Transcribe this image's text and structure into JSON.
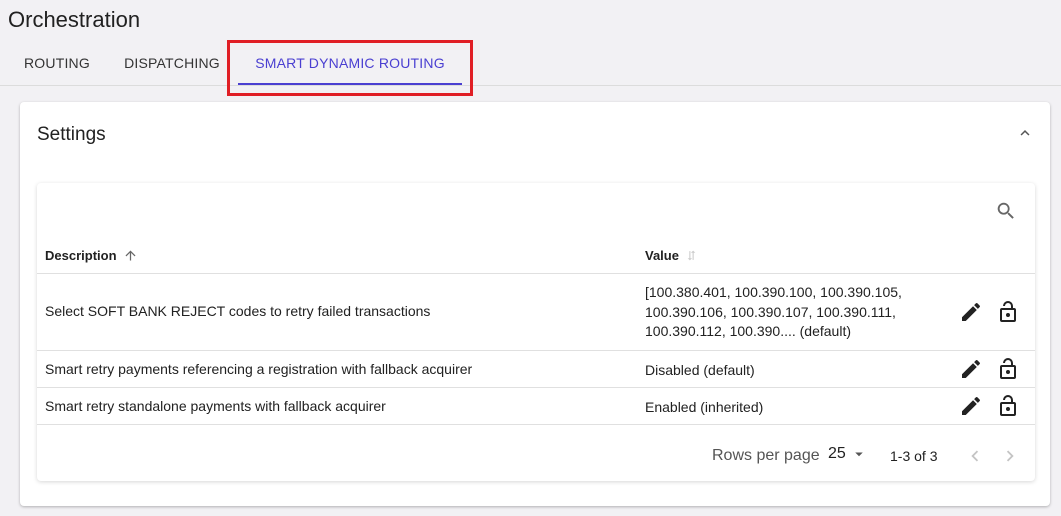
{
  "page": {
    "title": "Orchestration"
  },
  "tabs": [
    {
      "label": "ROUTING"
    },
    {
      "label": "DISPATCHING"
    },
    {
      "label": "SMART DYNAMIC ROUTING",
      "active": true
    }
  ],
  "settings": {
    "title": "Settings",
    "table": {
      "columns": {
        "description": "Description",
        "value": "Value"
      },
      "rows": [
        {
          "description": "Select SOFT BANK REJECT codes to retry failed transactions",
          "value": "[100.380.401, 100.390.100, 100.390.105, 100.390.106, 100.390.107, 100.390.111, 100.390.112, 100.390.... (default)"
        },
        {
          "description": "Smart retry payments referencing a registration with fallback acquirer",
          "value": "Disabled (default)"
        },
        {
          "description": "Smart retry standalone payments with fallback acquirer",
          "value": "Enabled (inherited)"
        }
      ],
      "footer": {
        "rows_per_page_label": "Rows per page",
        "rows_per_page": "25",
        "range": "1-3 of 3"
      }
    }
  },
  "colors": {
    "accent": "#4a3fd1",
    "highlight_box": "#e01e25",
    "background": "#f2f1f4"
  },
  "icons": [
    "chevron-up-icon",
    "search-icon",
    "arrow-up-icon",
    "sort-icon",
    "pencil-icon",
    "unlock-icon",
    "caret-down-icon",
    "chevron-left-icon",
    "chevron-right-icon"
  ]
}
